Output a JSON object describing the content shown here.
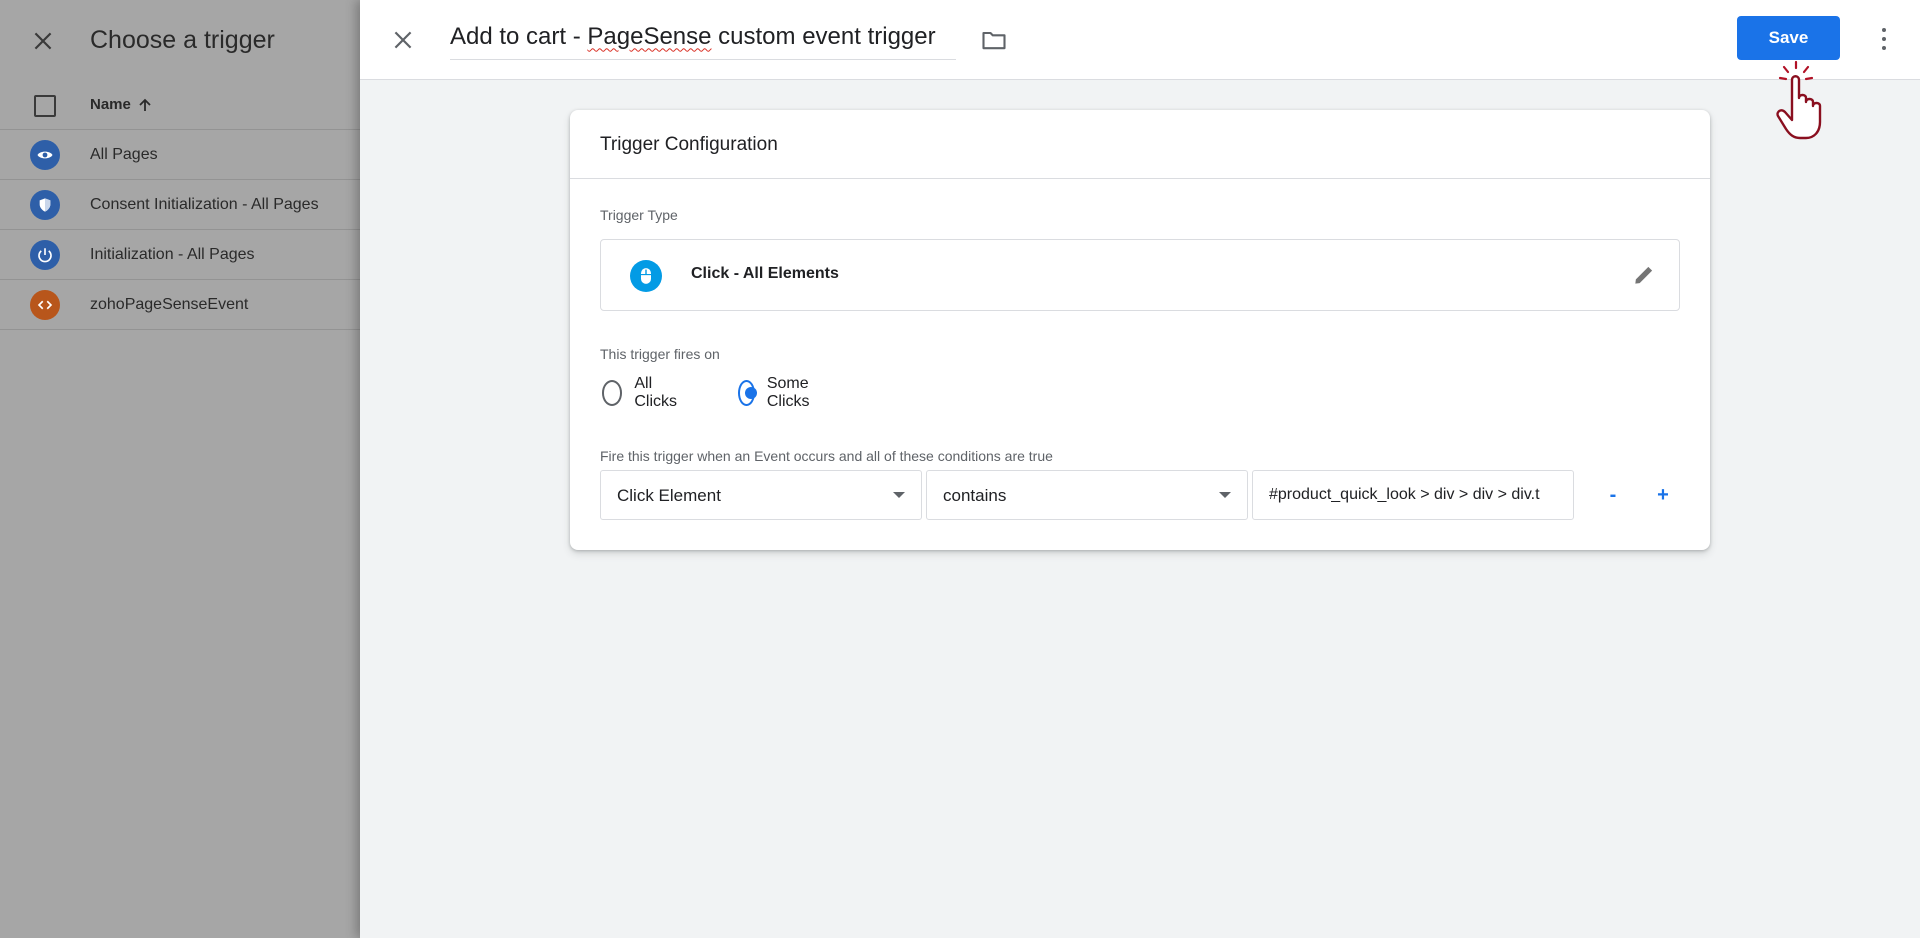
{
  "trigger_list": {
    "title": "Choose a trigger",
    "column_name": "Name",
    "sort_icon": "arrow-up-icon",
    "items": [
      {
        "label": "All Pages",
        "icon": "eye-icon",
        "color": "#2e5fa8"
      },
      {
        "label": "Consent Initialization - All Pages",
        "icon": "shield-icon",
        "color": "#2e5fa8"
      },
      {
        "label": "Initialization - All Pages",
        "icon": "power-icon",
        "color": "#2e5fa8"
      },
      {
        "label": "zohoPageSenseEvent",
        "icon": "code-icon",
        "color": "#b8561b"
      }
    ]
  },
  "editor": {
    "title_before": "Add to cart - ",
    "title_misspelled": "PageSense",
    "title_after": " custom event trigger",
    "save_label": "Save",
    "accent_color": "#1a73e8"
  },
  "config": {
    "card_title": "Trigger Configuration",
    "trigger_type_label": "Trigger Type",
    "trigger_type_value": "Click - All Elements",
    "fires_on_label": "This trigger fires on",
    "options": [
      {
        "label": "All Clicks",
        "checked": false
      },
      {
        "label": "Some Clicks",
        "checked": true
      }
    ],
    "conditions_label": "Fire this trigger when an Event occurs and all of these conditions are true",
    "condition": {
      "variable": "Click Element",
      "operator": "contains",
      "value": "#product_quick_look > div > div > div.t"
    },
    "remove_label": "-",
    "add_label": "+"
  }
}
